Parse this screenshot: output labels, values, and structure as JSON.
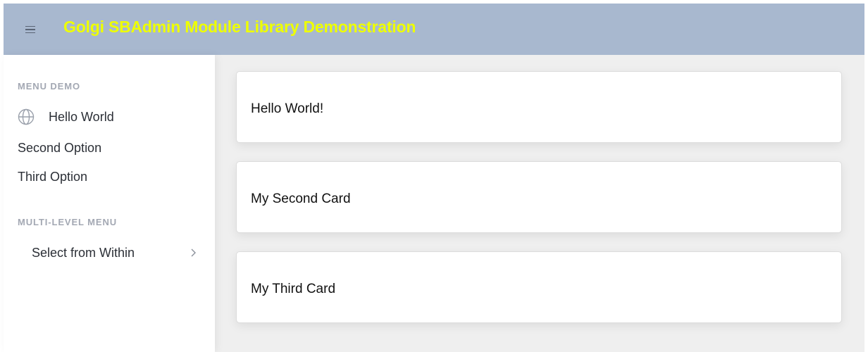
{
  "header": {
    "title": "Golgi SBAdmin Module Library Demonstration",
    "toggle_icon": "hamburger-menu-icon",
    "background_color": "#a8b8cf",
    "title_color": "#eeff00"
  },
  "sidebar": {
    "sections": [
      {
        "heading": "MENU DEMO",
        "items": [
          {
            "label": "Hello World",
            "icon": "globe-icon"
          },
          {
            "label": "Second Option"
          },
          {
            "label": "Third Option"
          }
        ]
      },
      {
        "heading": "MULTI-LEVEL MENU",
        "items": [
          {
            "label": "Select from Within",
            "icon": "chevron-right-icon"
          }
        ]
      }
    ]
  },
  "main": {
    "background_color": "#efefef",
    "cards": [
      {
        "text": "Hello World!"
      },
      {
        "text": "My Second Card"
      },
      {
        "text": "My Third Card"
      }
    ]
  }
}
